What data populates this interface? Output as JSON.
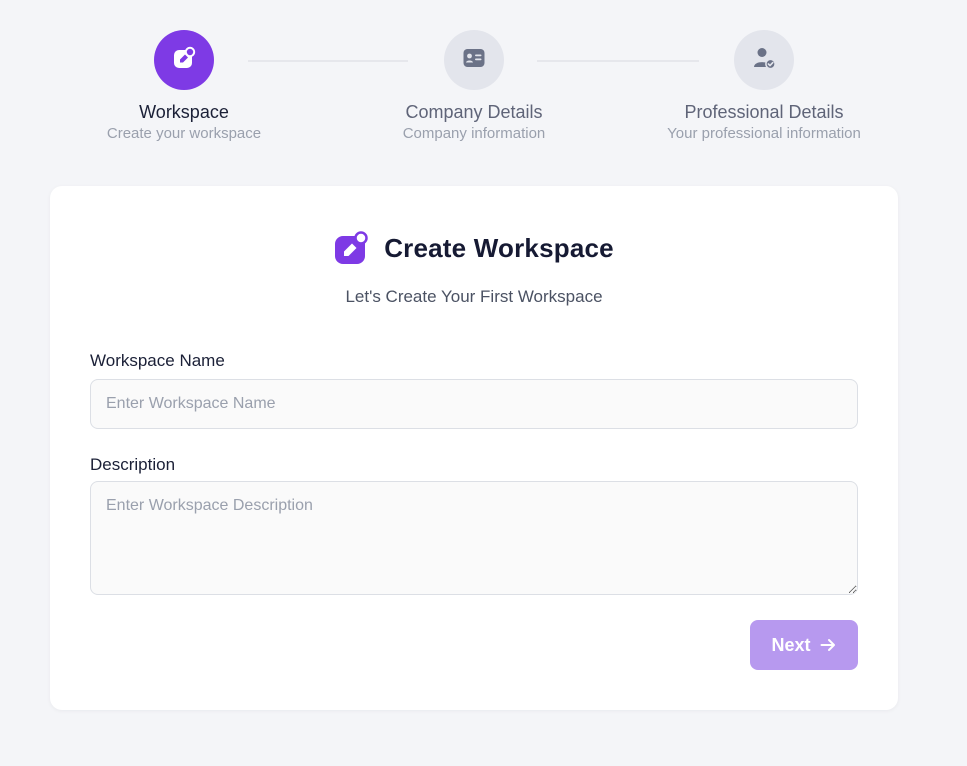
{
  "stepper": {
    "steps": [
      {
        "title": "Workspace",
        "subtitle": "Create your workspace",
        "icon": "workspace-icon",
        "state": "active"
      },
      {
        "title": "Company Details",
        "subtitle": "Company information",
        "icon": "id-card-icon",
        "state": "pending"
      },
      {
        "title": "Professional Details",
        "subtitle": "Your professional information",
        "icon": "user-check-icon",
        "state": "pending"
      }
    ]
  },
  "card": {
    "icon": "workspace-icon",
    "title": "Create Workspace",
    "subtitle": "Let's Create Your First Workspace"
  },
  "form": {
    "name_label": "Workspace Name",
    "name_placeholder": "Enter Workspace Name",
    "name_value": "",
    "description_label": "Description",
    "description_placeholder": "Enter Workspace Description",
    "description_value": ""
  },
  "actions": {
    "next_label": "Next",
    "next_icon": "arrow-right-icon"
  },
  "colors": {
    "accent": "#7e3ae5",
    "button_disabled": "#b799ef",
    "background": "#f4f5f8",
    "step_inactive": "#e3e5ec"
  }
}
